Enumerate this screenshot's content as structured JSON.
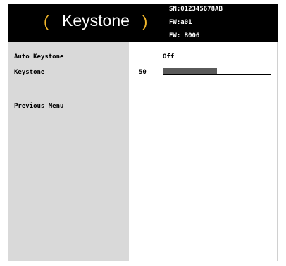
{
  "title": {
    "bracket_left": "(",
    "text": "Keystone",
    "bracket_right": ")"
  },
  "info": {
    "sn": "SN:012345678AB",
    "fw1": "FW:a01",
    "fw2": "FW: B006"
  },
  "menu": {
    "items": [
      {
        "label": "Auto Keystone",
        "value": "Off"
      },
      {
        "label": "Keystone",
        "value": "50",
        "slider_percent": 50
      },
      {
        "label": "Previous Menu"
      }
    ]
  },
  "colors": {
    "title_bar": "#000000",
    "bracket_accent": "#f2b62a",
    "left_panel": "#d9d9d9",
    "slider_fill": "#5a5a5a"
  }
}
